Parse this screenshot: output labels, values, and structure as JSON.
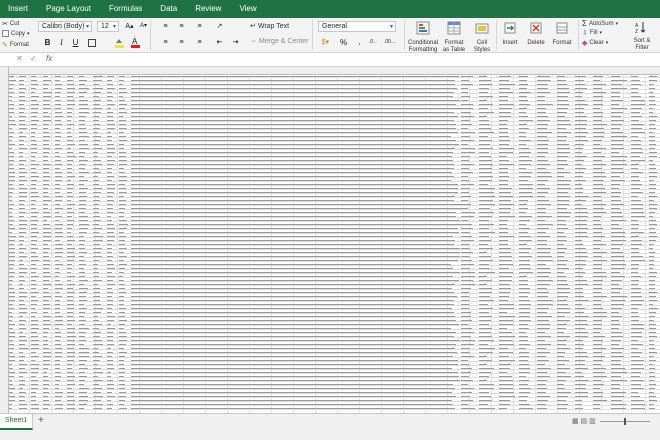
{
  "ribbon_tabs": [
    "Insert",
    "Page Layout",
    "Formulas",
    "Data",
    "Review",
    "View"
  ],
  "clipboard": {
    "cut": "Cut",
    "copy": "Copy",
    "format": "Format"
  },
  "font": {
    "name": "Calibri (Body)",
    "size": "12"
  },
  "alignment": {
    "wrap_text": "Wrap Text",
    "merge_center": "Merge & Center"
  },
  "number": {
    "format": "General"
  },
  "styles": {
    "conditional_formatting": [
      "Conditional",
      "Formatting"
    ],
    "format_as_table": [
      "Format",
      "as Table"
    ],
    "cell_styles": [
      "Cell",
      "Styles"
    ]
  },
  "cells": {
    "insert": "Insert",
    "delete": "Delete",
    "format": "Format"
  },
  "editing": {
    "autosum": "AutoSum",
    "fill": "Fill",
    "clear": "Clear",
    "sort_filter": [
      "Sort &",
      "Filter"
    ]
  },
  "formula_bar": {
    "fx": "fx"
  },
  "sheet_tabs": [
    "Sheet1"
  ],
  "colors": {
    "ribbon_green": "#1f7244",
    "font_color": "#e02020",
    "fill_color": "#f4e04d"
  }
}
